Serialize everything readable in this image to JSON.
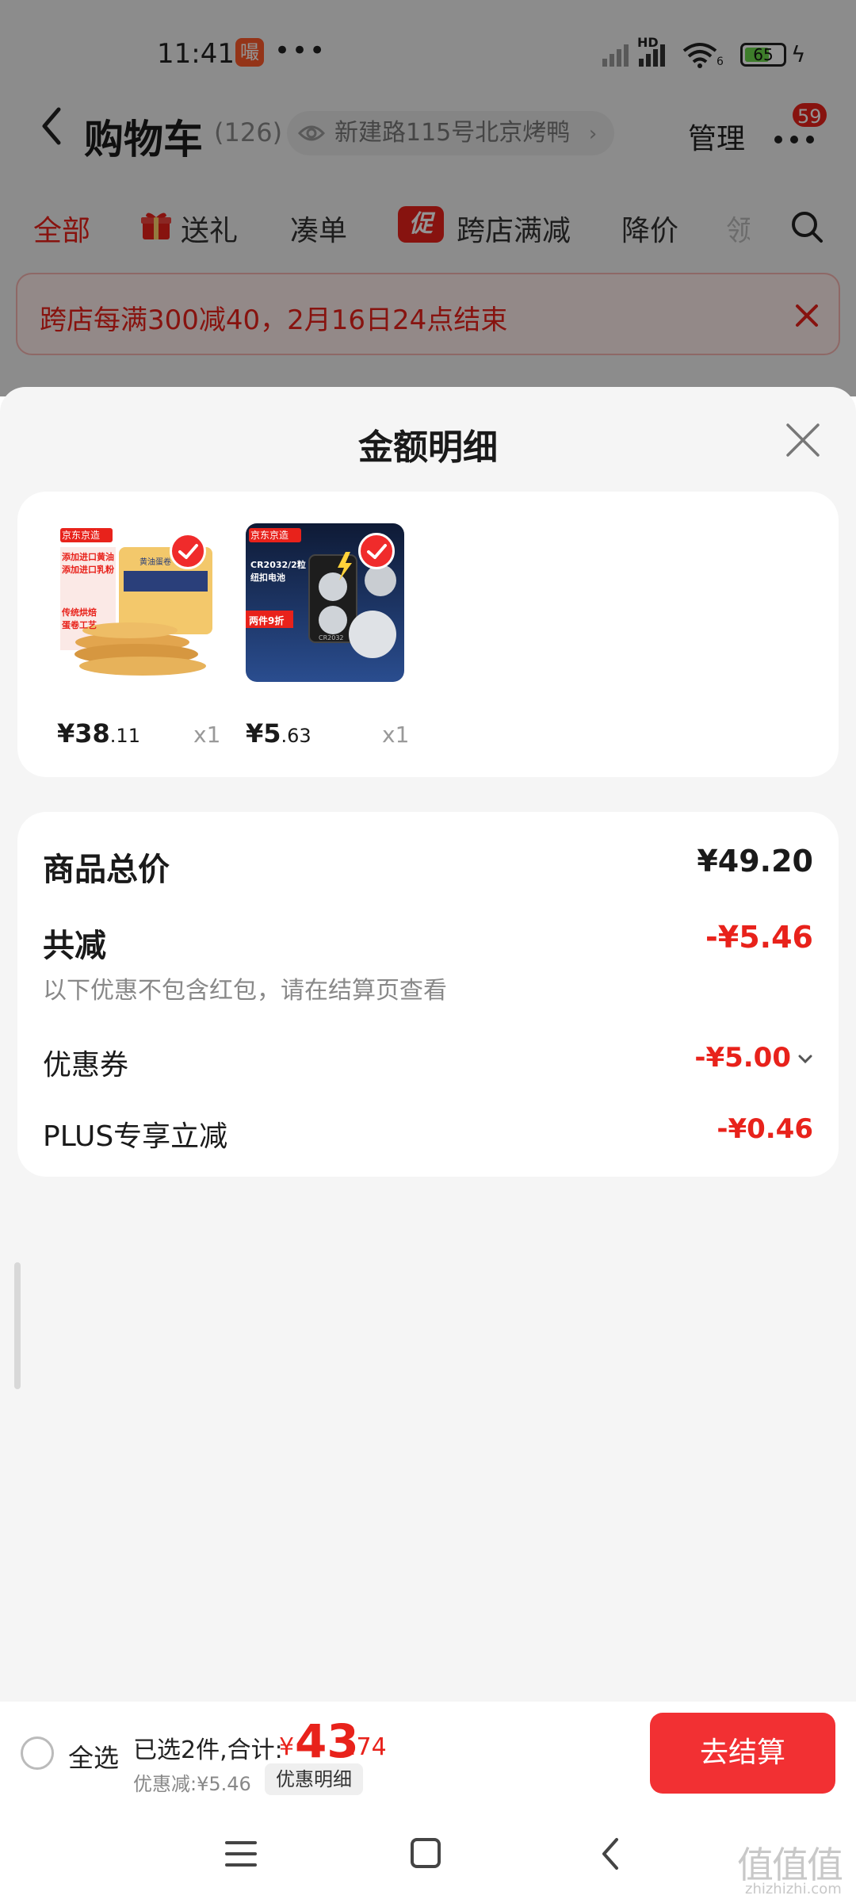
{
  "status_bar": {
    "time": "11:41",
    "app_icon_char": "嘬",
    "dots": "•••",
    "network_label": "HD",
    "wifi_label": "6",
    "battery": "65",
    "battery_level": 0.65
  },
  "header": {
    "title": "购物车",
    "count": "(126)",
    "location": "新建路115号北京烤鸭",
    "manage_label": "管理",
    "message_badge": "59"
  },
  "tabs": [
    {
      "label": "全部",
      "active": true
    },
    {
      "label": "送礼"
    },
    {
      "label": "凑单"
    },
    {
      "label": "跨店满减",
      "icon_char": "促"
    },
    {
      "label": "降价"
    },
    {
      "label": "领"
    }
  ],
  "promo_banner": {
    "text": "跨店每满300减40，2月16日24点结束"
  },
  "sheet": {
    "title": "金额明细",
    "products": [
      {
        "price_int": "¥38",
        "price_dec": ".11",
        "qty": "x1",
        "image_texts": [
          "京东京造",
          "黄油蛋卷",
          "添加进口黄油",
          "添加进口乳粉",
          "传统烘焙",
          "蛋卷工艺"
        ]
      },
      {
        "price_int": "¥5",
        "price_dec": ".63",
        "qty": "x1",
        "image_texts": [
          "京东京造",
          "CR2032/2粒",
          "纽扣电池",
          "两件9折",
          "CR2032"
        ]
      }
    ],
    "summary": {
      "total_label": "商品总价",
      "total_value": "¥49.20",
      "discount_label": "共减",
      "discount_value": "-¥5.46",
      "discount_note": "以下优惠不包含红包，请在结算页查看",
      "coupon_label": "优惠券",
      "coupon_value": "-¥5.00",
      "plus_label": "PLUS专享立减",
      "plus_value": "-¥0.46"
    }
  },
  "checkout": {
    "select_all": "全选",
    "selected_text": "已选2件,合计:",
    "yen": "¥",
    "total_int": "43",
    "total_dec": ".74",
    "discount_text": "优惠减:¥5.46",
    "discount_detail": "优惠明细",
    "checkout_button": "去结算"
  },
  "watermark": {
    "glyphs": "值值值",
    "text": "zhizhizhi.com"
  },
  "colors": {
    "accent_red": "#e8221b",
    "button_red": "#f23033",
    "sheet_bg": "#f5f5f5"
  }
}
